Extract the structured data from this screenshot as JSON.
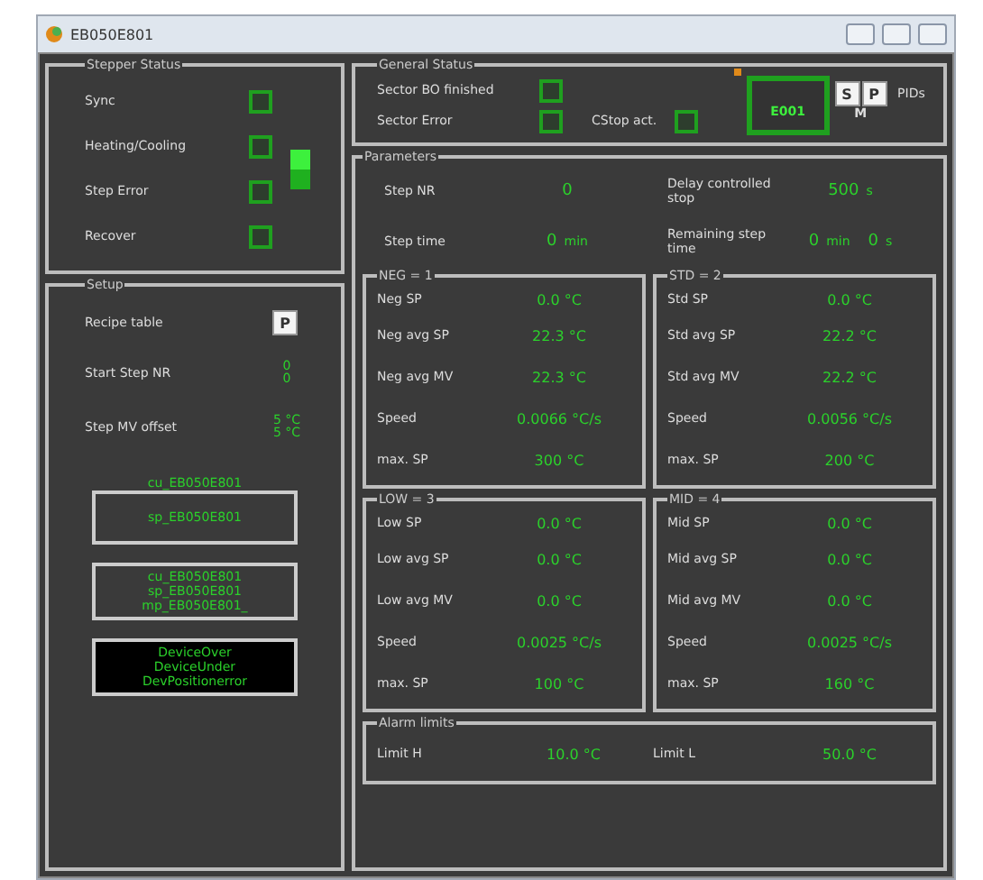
{
  "window": {
    "title": "EB050E801"
  },
  "stepper_status": {
    "title": "Stepper Status",
    "items": [
      {
        "label": "Sync",
        "on": false
      },
      {
        "label": "Heating/Cooling",
        "on": false
      },
      {
        "label": "Step Error",
        "on": false
      },
      {
        "label": "Recover",
        "on": false
      }
    ]
  },
  "setup": {
    "title": "Setup",
    "recipe_table": {
      "label": "Recipe table",
      "button": "P"
    },
    "rows": [
      {
        "label": "Start Step NR",
        "values": [
          "0",
          "0"
        ]
      },
      {
        "label": "Step MV offset",
        "values": [
          "5 °C",
          "5 °C"
        ]
      }
    ],
    "tag_caption": "cu_EB050E801",
    "tag_boxes": [
      {
        "kind": "outline",
        "lines": [
          "sp_EB050E801"
        ]
      },
      {
        "kind": "outline",
        "lines": [
          "cu_EB050E801",
          "sp_EB050E801",
          "mp_EB050E801_"
        ]
      },
      {
        "kind": "dark",
        "lines": [
          "DeviceOver",
          "DeviceUnder",
          "DevPositionerror"
        ]
      }
    ]
  },
  "general_status": {
    "title": "General Status",
    "items": [
      {
        "label": "Sector BO finished",
        "on": false
      },
      {
        "label": "Sector Error",
        "on": false
      },
      {
        "label": "CStop act.",
        "on": false
      }
    ],
    "display": "E001",
    "buttons": [
      "S",
      "P"
    ],
    "mode": "M",
    "pids_label": "PIDs"
  },
  "parameters": {
    "title": "Parameters",
    "fields": [
      {
        "label": "Step NR",
        "value": "0"
      },
      {
        "label": "Delay controlled stop",
        "value": "500",
        "unit": "s"
      },
      {
        "label": "Step time",
        "value": "0",
        "unit": "min"
      },
      {
        "label": "Remaining step time",
        "value": "0",
        "unit": "min",
        "value2": "0",
        "unit2": "s"
      }
    ],
    "groups": [
      {
        "title": "NEG = 1",
        "rows": [
          {
            "label": "Neg SP",
            "value": "0.0 °C"
          },
          {
            "label": "Neg avg SP",
            "value": "22.3 °C"
          },
          {
            "label": "Neg avg MV",
            "value": "22.3 °C"
          },
          {
            "label": "Speed",
            "value": "0.0066 °C/s"
          },
          {
            "label": "max. SP",
            "value": "300 °C"
          }
        ]
      },
      {
        "title": "STD = 2",
        "rows": [
          {
            "label": "Std SP",
            "value": "0.0 °C"
          },
          {
            "label": "Std avg SP",
            "value": "22.2 °C"
          },
          {
            "label": "Std avg MV",
            "value": "22.2 °C"
          },
          {
            "label": "Speed",
            "value": "0.0056 °C/s"
          },
          {
            "label": "max. SP",
            "value": "200 °C"
          }
        ]
      },
      {
        "title": "LOW = 3",
        "rows": [
          {
            "label": "Low SP",
            "value": "0.0 °C"
          },
          {
            "label": "Low avg SP",
            "value": "0.0 °C"
          },
          {
            "label": "Low avg MV",
            "value": "0.0 °C"
          },
          {
            "label": "Speed",
            "value": "0.0025 °C/s"
          },
          {
            "label": "max. SP",
            "value": "100 °C"
          }
        ]
      },
      {
        "title": "MID = 4",
        "rows": [
          {
            "label": "Mid SP",
            "value": "0.0 °C"
          },
          {
            "label": "Mid avg SP",
            "value": "0.0 °C"
          },
          {
            "label": "Mid avg MV",
            "value": "0.0 °C"
          },
          {
            "label": "Speed",
            "value": "0.0025 °C/s"
          },
          {
            "label": "max. SP",
            "value": "160 °C"
          }
        ]
      }
    ],
    "alarm_limits": {
      "title": "Alarm limits",
      "items": [
        {
          "label": "Limit H",
          "value": "10.0 °C"
        },
        {
          "label": "Limit L",
          "value": "50.0 °C"
        }
      ]
    }
  }
}
